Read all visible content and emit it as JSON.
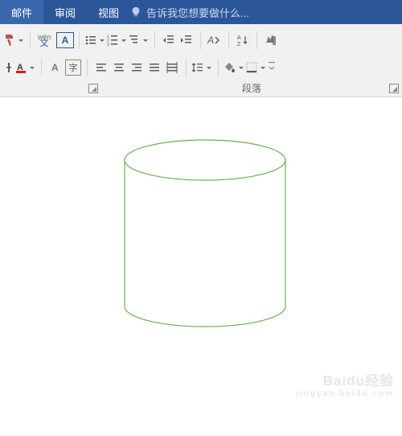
{
  "tabs": {
    "mail": "邮件",
    "review": "审阅",
    "view": "视图",
    "tell_me": "告诉我您想要做什么..."
  },
  "ribbon": {
    "font_label": "",
    "paragraph_label": "段落",
    "wen_top": "wén",
    "wen_bot": "文",
    "A_char": "A",
    "zi_char": "字"
  },
  "icons": {
    "bulb": "bulb-icon",
    "format_brush": "format-brush-icon",
    "phonetic": "phonetic-guide-icon",
    "char_border": "char-border-icon",
    "bullets": "bullets-icon",
    "numbering": "numbering-icon",
    "multilevel": "multilevel-list-icon",
    "dec_indent": "decrease-indent-icon",
    "inc_indent": "increase-indent-icon",
    "clear_format": "clear-format-icon",
    "sort": "sort-icon",
    "show_marks": "show-marks-icon",
    "strike": "strikethrough-icon",
    "font_color": "font-color-icon",
    "highlight": "highlight-icon",
    "char_shading": "char-shading-icon",
    "align_l": "align-left-icon",
    "align_c": "align-center-icon",
    "align_r": "align-right-icon",
    "align_j": "align-justify-icon",
    "dist": "distribute-icon",
    "line_sp": "line-spacing-icon",
    "shading": "shading-icon",
    "borders": "borders-icon"
  },
  "watermark": {
    "main": "Baidu经验",
    "sub": "jingyan.baidu.com"
  }
}
